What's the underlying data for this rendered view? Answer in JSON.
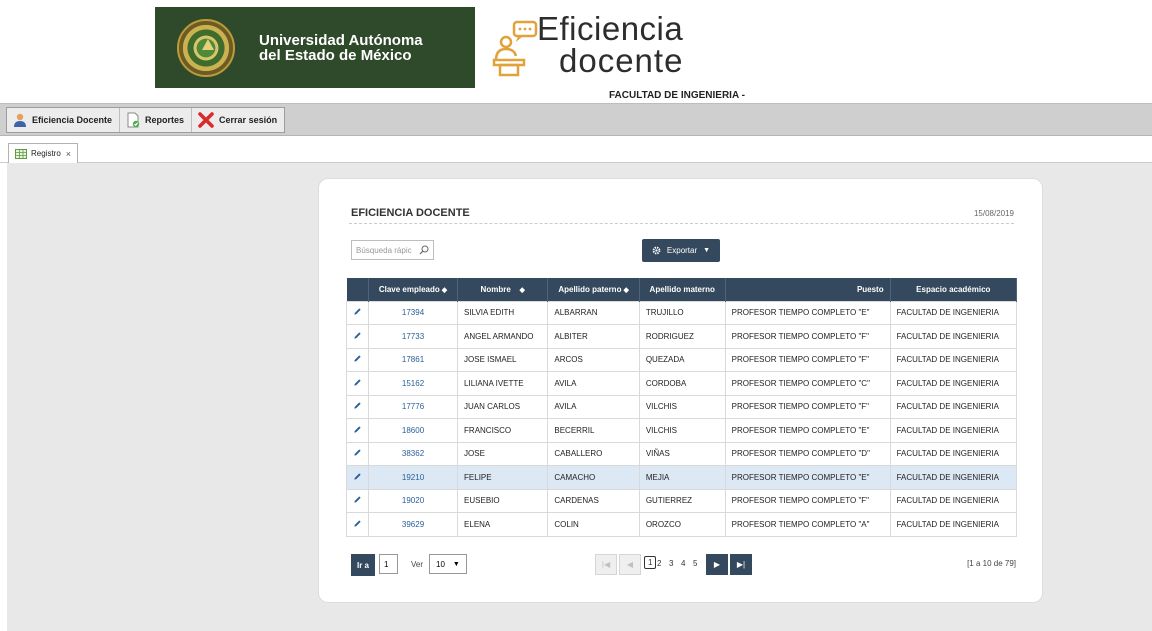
{
  "header": {
    "university_line1": "Universidad Autónoma",
    "university_line2": "del Estado de México",
    "app_name_line1": "Eficiencia",
    "app_name_line2": "docente",
    "faculty": "FACULTAD DE INGENIERIA -"
  },
  "menu": {
    "items": [
      {
        "label": "Eficiencia Docente",
        "icon": "user-icon"
      },
      {
        "label": "Reportes",
        "icon": "report-icon"
      },
      {
        "label": "Cerrar sesión",
        "icon": "close-x-icon"
      }
    ]
  },
  "tabs": [
    {
      "label": "Registro",
      "icon": "grid-icon",
      "close": "×"
    }
  ],
  "panel": {
    "title": "EFICIENCIA DOCENTE",
    "date": "15/08/2019",
    "search_placeholder": "Búsqueda rápic",
    "export_label": "Exportar"
  },
  "table": {
    "columns": [
      "Clave empleado",
      "Nombre",
      "Apellido paterno",
      "Apellido materno",
      "Puesto",
      "Espacio académico"
    ],
    "rows": [
      {
        "clave": "17394",
        "nombre": "SILVIA EDITH",
        "paterno": "ALBARRAN",
        "materno": "TRUJILLO",
        "puesto": "PROFESOR TIEMPO COMPLETO \"E\"",
        "espacio": "FACULTAD DE INGENIERIA"
      },
      {
        "clave": "17733",
        "nombre": "ANGEL ARMANDO",
        "paterno": "ALBITER",
        "materno": "RODRIGUEZ",
        "puesto": "PROFESOR TIEMPO COMPLETO \"F\"",
        "espacio": "FACULTAD DE INGENIERIA"
      },
      {
        "clave": "17861",
        "nombre": "JOSE ISMAEL",
        "paterno": "ARCOS",
        "materno": "QUEZADA",
        "puesto": "PROFESOR TIEMPO COMPLETO \"F\"",
        "espacio": "FACULTAD DE INGENIERIA"
      },
      {
        "clave": "15162",
        "nombre": "LILIANA IVETTE",
        "paterno": "AVILA",
        "materno": "CORDOBA",
        "puesto": "PROFESOR TIEMPO COMPLETO \"C\"",
        "espacio": "FACULTAD DE INGENIERIA"
      },
      {
        "clave": "17776",
        "nombre": "JUAN CARLOS",
        "paterno": "AVILA",
        "materno": "VILCHIS",
        "puesto": "PROFESOR TIEMPO COMPLETO \"F\"",
        "espacio": "FACULTAD DE INGENIERIA"
      },
      {
        "clave": "18600",
        "nombre": "FRANCISCO",
        "paterno": "BECERRIL",
        "materno": "VILCHIS",
        "puesto": "PROFESOR TIEMPO COMPLETO \"E\"",
        "espacio": "FACULTAD DE INGENIERIA"
      },
      {
        "clave": "38362",
        "nombre": "JOSE",
        "paterno": "CABALLERO",
        "materno": "VIÑAS",
        "puesto": "PROFESOR TIEMPO COMPLETO \"D\"",
        "espacio": "FACULTAD DE INGENIERIA"
      },
      {
        "clave": "19210",
        "nombre": "FELIPE",
        "paterno": "CAMACHO",
        "materno": "MEJIA",
        "puesto": "PROFESOR TIEMPO COMPLETO \"E\"",
        "espacio": "FACULTAD DE INGENIERIA"
      },
      {
        "clave": "19020",
        "nombre": "EUSEBIO",
        "paterno": "CARDENAS",
        "materno": "GUTIERREZ",
        "puesto": "PROFESOR TIEMPO COMPLETO \"F\"",
        "espacio": "FACULTAD DE INGENIERIA"
      },
      {
        "clave": "39629",
        "nombre": "ELENA",
        "paterno": "COLIN",
        "materno": "OROZCO",
        "puesto": "PROFESOR TIEMPO COMPLETO \"A\"",
        "espacio": "FACULTAD DE INGENIERIA"
      }
    ],
    "selected_row_index": 7
  },
  "pager": {
    "goto_label": "Ir a",
    "goto_value": "1",
    "ver_label": "Ver",
    "page_size": "10",
    "pages": [
      "1",
      "2",
      "3",
      "4",
      "5"
    ],
    "current_page": "1",
    "info": "[1 a 10 de 79]"
  },
  "colors": {
    "header_green": "#2f4a2a",
    "table_header": "#34495e",
    "selected_row": "#dde8f5",
    "link_blue": "#2a6099"
  }
}
